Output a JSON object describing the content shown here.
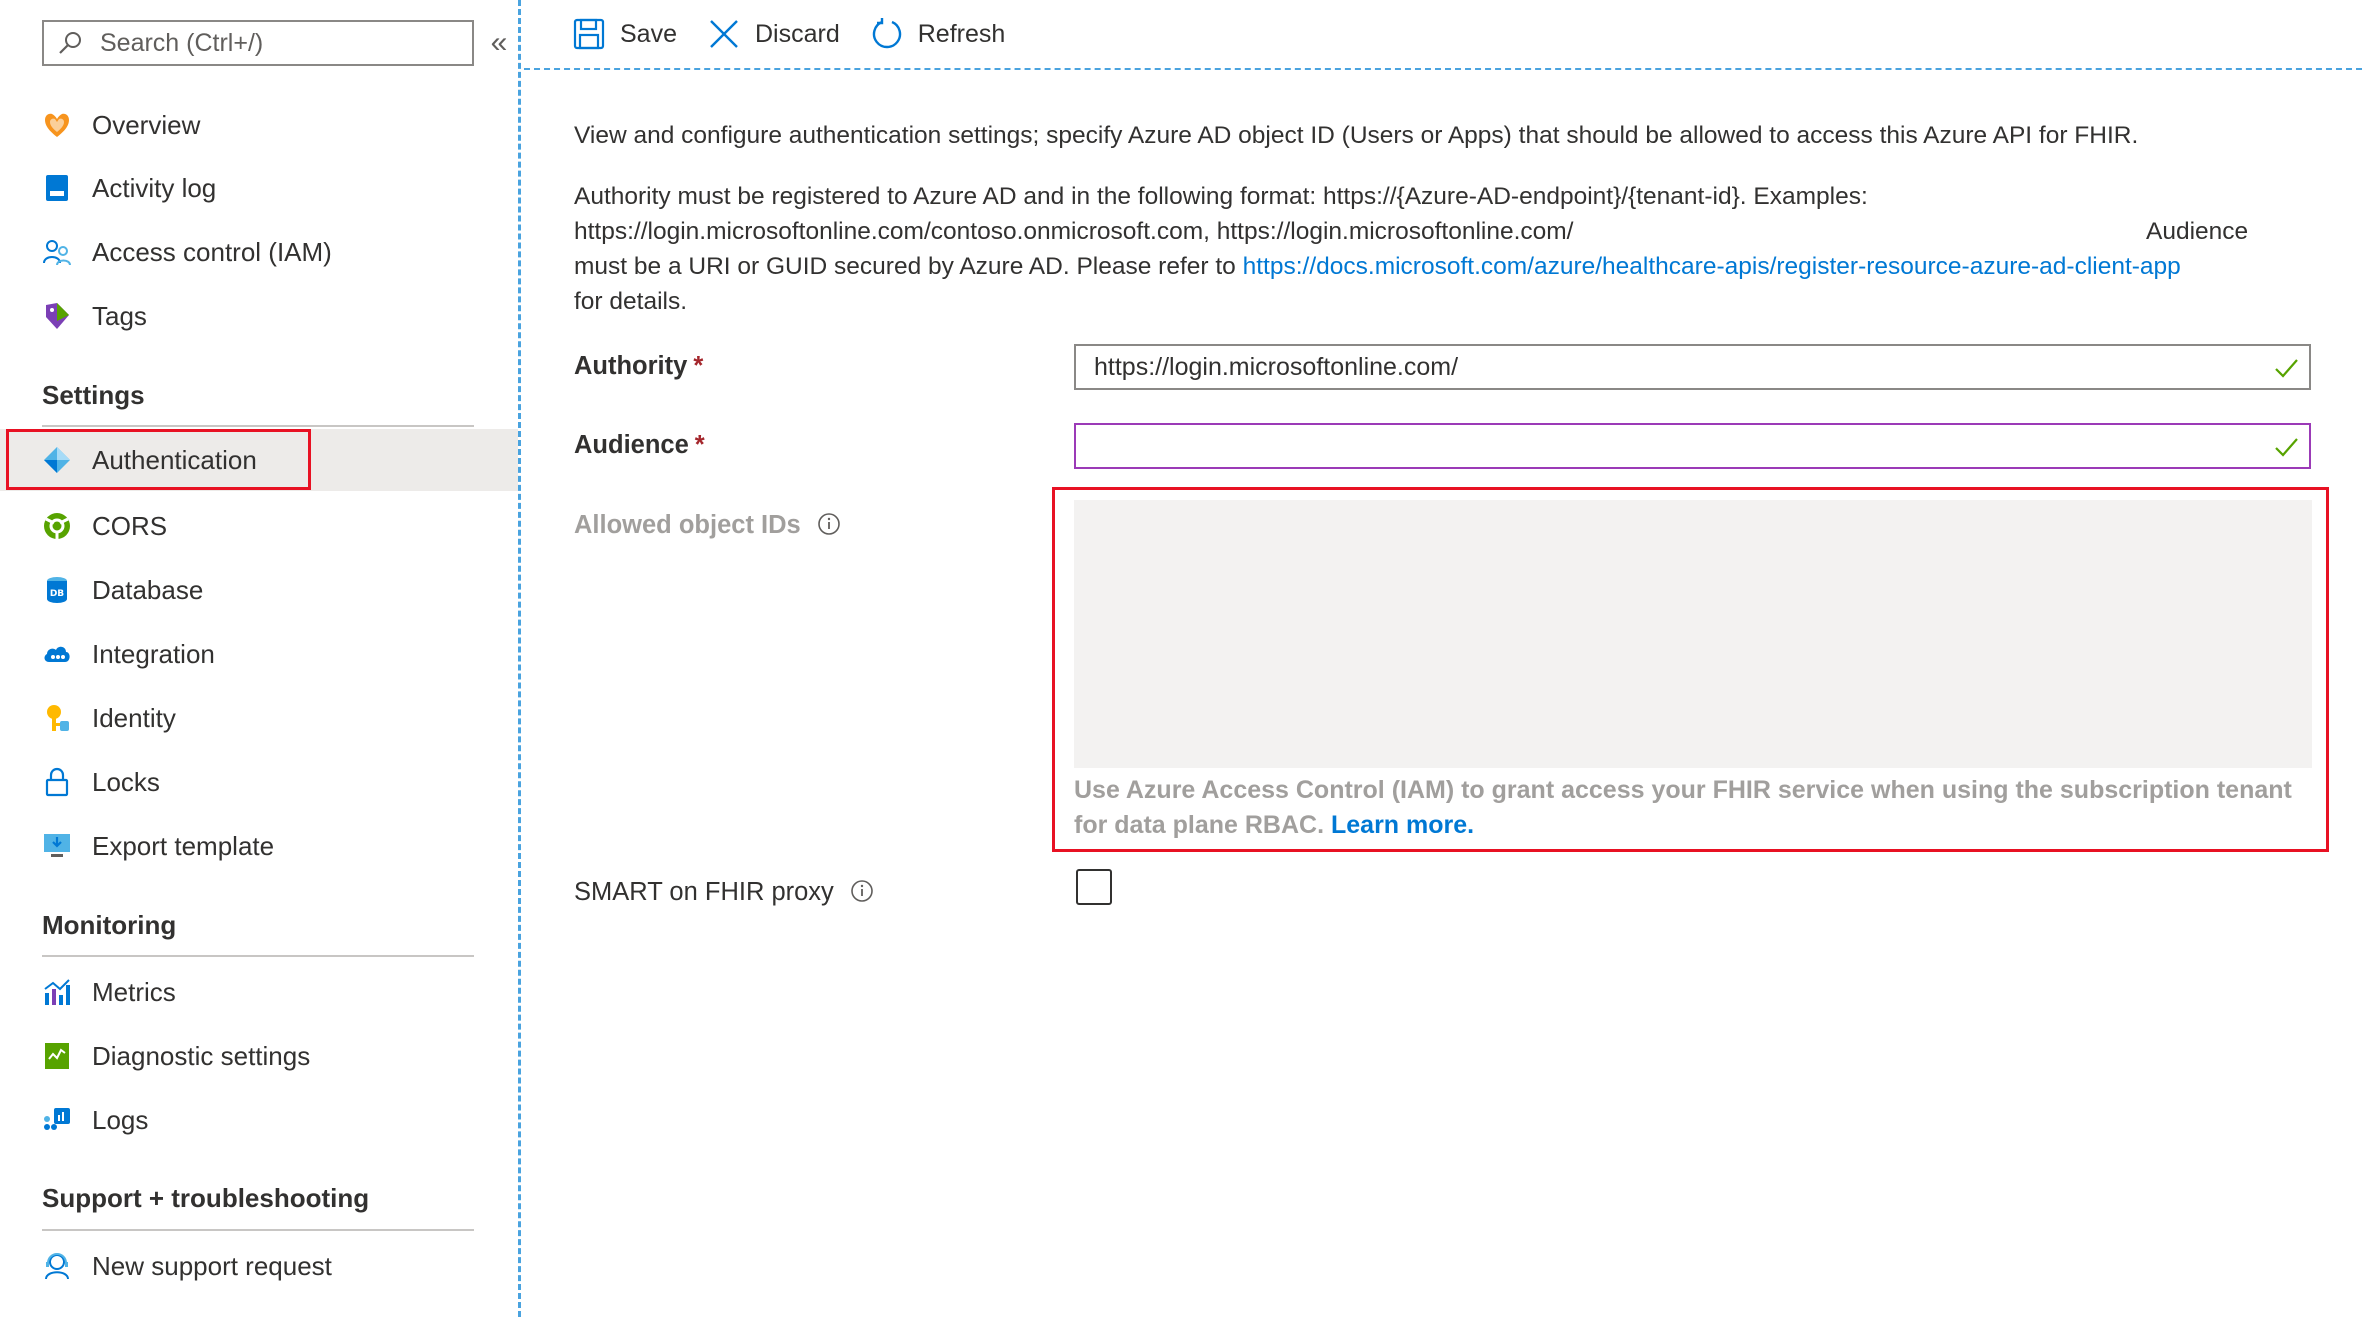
{
  "search": {
    "placeholder": "Search (Ctrl+/)"
  },
  "sidebar": {
    "top_items": [
      {
        "label": "Overview",
        "icon": "overview-icon"
      },
      {
        "label": "Activity log",
        "icon": "activity-log-icon"
      },
      {
        "label": "Access control (IAM)",
        "icon": "access-control-icon"
      },
      {
        "label": "Tags",
        "icon": "tags-icon"
      }
    ],
    "settings": {
      "header": "Settings",
      "items": [
        {
          "label": "Authentication",
          "icon": "authentication-icon",
          "selected": true
        },
        {
          "label": "CORS",
          "icon": "cors-icon"
        },
        {
          "label": "Database",
          "icon": "database-icon"
        },
        {
          "label": "Integration",
          "icon": "integration-icon"
        },
        {
          "label": "Identity",
          "icon": "identity-icon"
        },
        {
          "label": "Locks",
          "icon": "lock-icon"
        },
        {
          "label": "Export template",
          "icon": "export-template-icon"
        }
      ]
    },
    "monitoring": {
      "header": "Monitoring",
      "items": [
        {
          "label": "Metrics",
          "icon": "metrics-icon"
        },
        {
          "label": "Diagnostic settings",
          "icon": "diagnostic-settings-icon"
        },
        {
          "label": "Logs",
          "icon": "logs-icon"
        }
      ]
    },
    "support": {
      "header": "Support + troubleshooting",
      "items": [
        {
          "label": "New support request",
          "icon": "support-request-icon"
        }
      ]
    }
  },
  "toolbar": {
    "save_label": "Save",
    "discard_label": "Discard",
    "refresh_label": "Refresh"
  },
  "main": {
    "intro": "View and configure authentication settings; specify Azure AD object ID (Users or Apps) that should be allowed to access this Azure API for FHIR.",
    "authority_line1": "Authority must be registered to Azure AD and in the following format: https://{Azure-AD-endpoint}/{tenant-id}. Examples:",
    "authority_line2_a": "https://login.microsoftonline.com/contoso.onmicrosoft.com, https://login.microsoftonline.com/",
    "authority_line2_b": "Audience",
    "authority_line3_a": "must be a URI or GUID secured by Azure AD. Please refer to ",
    "authority_link": "https://docs.microsoft.com/azure/healthcare-apis/register-resource-azure-ad-client-app",
    "authority_line4": "for details.",
    "authority_label": "Authority",
    "authority_value": "https://login.microsoftonline.com/",
    "audience_label": "Audience",
    "audience_value": "",
    "required_marker": "*",
    "allowed_ids_label": "Allowed object IDs",
    "allowed_ids_value": "",
    "helper_text": "Use Azure Access Control (IAM) to grant access your FHIR service when using the subscription tenant for data plane RBAC. ",
    "helper_link": "Learn more.",
    "smart_proxy_label": "SMART on FHIR proxy",
    "smart_proxy_checked": false
  },
  "colors": {
    "accent": "#0078d4",
    "highlight": "#e81123",
    "valid": "#57a300",
    "focus_border": "#9b3ab7"
  }
}
